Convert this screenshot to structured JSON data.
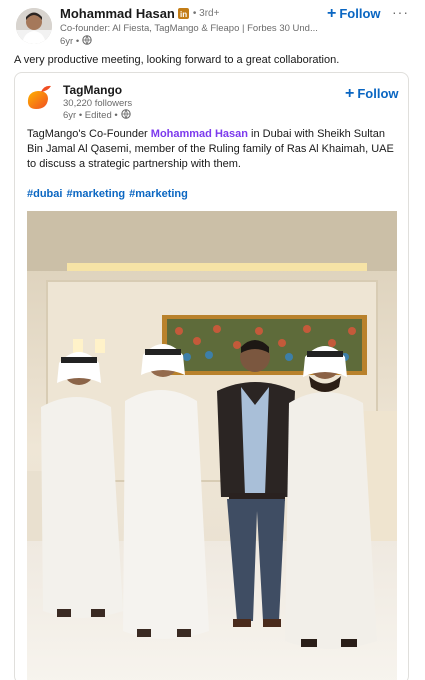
{
  "post": {
    "author_name": "Mohammad Hasan",
    "degree": "• 3rd+",
    "headline": "Co-founder: Al Fiesta, TagMango & Fleapo | Forbes 30 Und...",
    "age": "6yr •",
    "follow_label": "Follow",
    "more_label": "···",
    "commentary": "A very productive meeting, looking forward to a great collaboration."
  },
  "shared": {
    "org_name": "TagMango",
    "followers": "30,220 followers",
    "meta": "6yr • Edited •",
    "follow_label": "Follow",
    "text_before": "TagMango's Co-Founder ",
    "mention": "Mohammad Hasan",
    "text_after": " in Dubai with Sheikh Sultan Bin Jamal Al Qasemi, member of the Ruling family of Ras Al Khaimah, UAE to discuss a strategic partnership with them.",
    "hashtags": [
      "#dubai",
      "#marketing",
      "#marketing"
    ]
  },
  "colors": {
    "link_blue": "#0a66c2",
    "mention_purple": "#7c3aed",
    "muted": "#666666"
  },
  "icons": [
    "linkedin-badge-icon",
    "globe-icon",
    "plus-icon",
    "more-icon"
  ]
}
